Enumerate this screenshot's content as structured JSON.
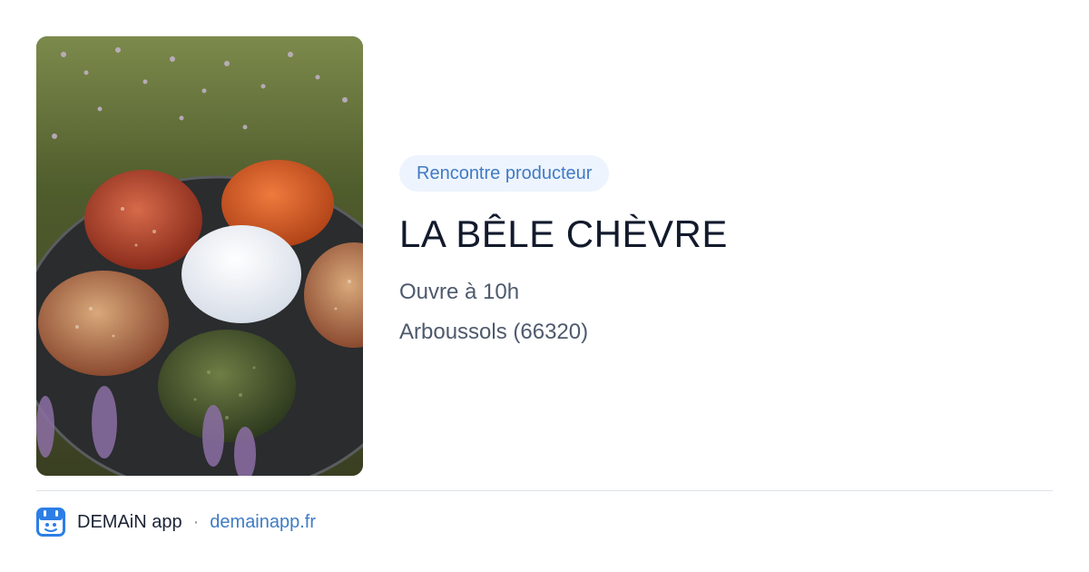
{
  "card": {
    "badge": "Rencontre producteur",
    "title": "LA BÊLE CHÈVRE",
    "hours": "Ouvre à 10h",
    "location": "Arboussols (66320)"
  },
  "footer": {
    "app_name": "DEMAiN app",
    "separator": "·",
    "domain": "demainapp.fr"
  },
  "colors": {
    "badge_bg": "#eef4fd",
    "accent": "#3f7bc4",
    "title": "#121a2c",
    "secondary_text": "#4e5a6d",
    "app_icon": "#2c7ee6"
  },
  "icons": {
    "app_logo": "demain-app-logo-icon"
  }
}
